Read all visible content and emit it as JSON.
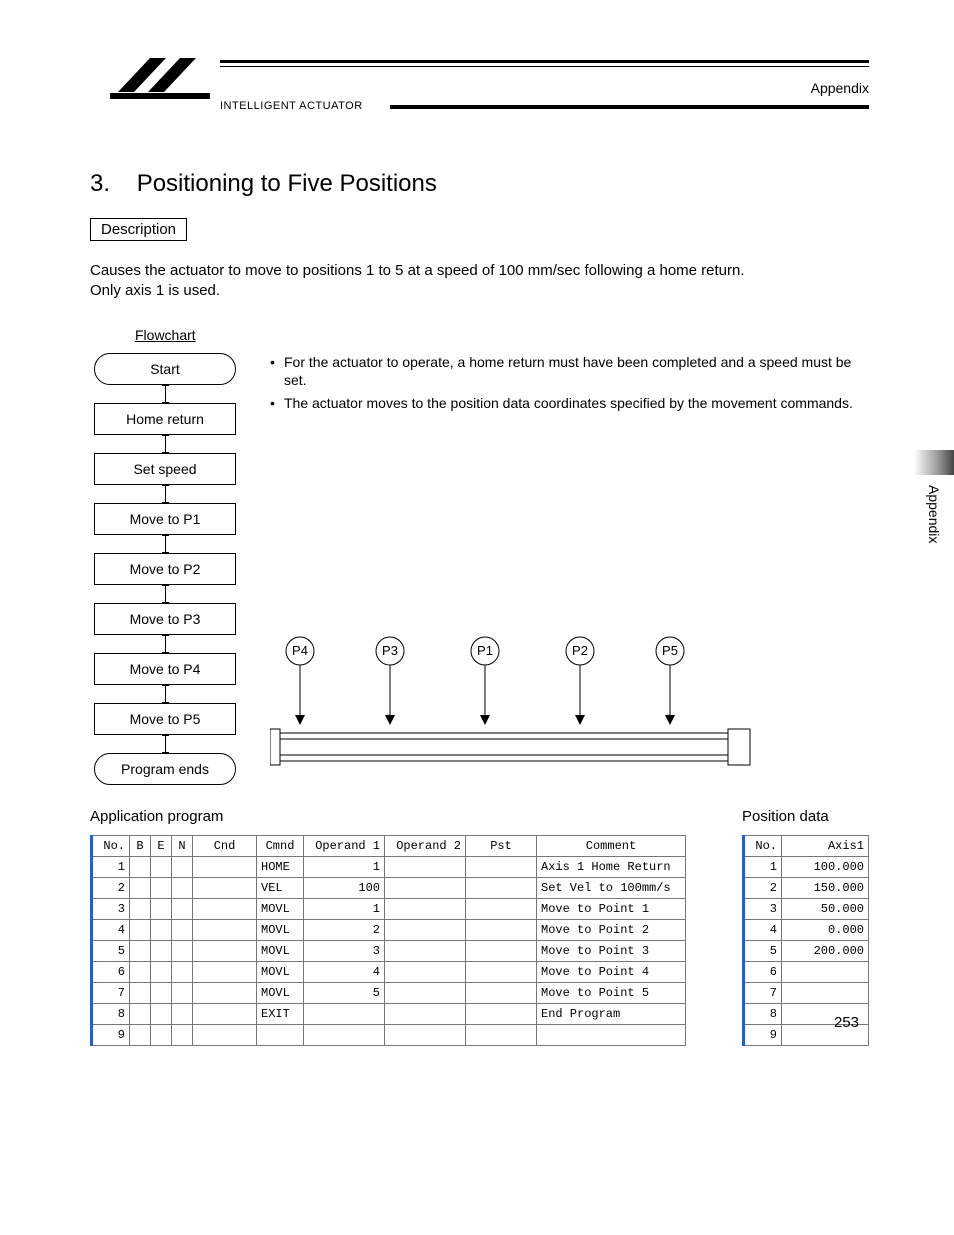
{
  "header": {
    "brand": "INTELLIGENT ACTUATOR",
    "appendix_label": "Appendix"
  },
  "section": {
    "number": "3.",
    "title": "Positioning to Five Positions",
    "description_label": "Description",
    "description_text_1": "Causes the actuator to move to positions 1 to 5 at a speed of 100 mm/sec following a home return.",
    "description_text_2": "Only axis 1 is used."
  },
  "flowchart": {
    "label": "Flowchart",
    "steps": [
      {
        "text": "Start",
        "shape": "oval"
      },
      {
        "text": "Home return",
        "shape": "rect"
      },
      {
        "text": "Set speed",
        "shape": "rect"
      },
      {
        "text": "Move to P1",
        "shape": "rect"
      },
      {
        "text": "Move to P2",
        "shape": "rect"
      },
      {
        "text": "Move to P3",
        "shape": "rect"
      },
      {
        "text": "Move to P4",
        "shape": "rect"
      },
      {
        "text": "Move to P5",
        "shape": "rect"
      },
      {
        "text": "Program ends",
        "shape": "oval"
      }
    ]
  },
  "notes": {
    "b1": "For the actuator to operate, a home return must have been completed and a speed must be set.",
    "b2": "The actuator moves to the position data coordinates specified by the movement commands."
  },
  "positions_diagram": {
    "labels": [
      "P4",
      "P3",
      "P1",
      "P2",
      "P5"
    ]
  },
  "side_tab": "Appendix",
  "app_program": {
    "title": "Application program",
    "headers": [
      "No.",
      "B",
      "E",
      "N",
      "Cnd",
      "Cmnd",
      "Operand 1",
      "Operand 2",
      "Pst",
      "Comment"
    ],
    "rows": [
      {
        "no": "1",
        "cmnd": "HOME",
        "op1": "1",
        "cmt": "Axis 1 Home Return"
      },
      {
        "no": "2",
        "cmnd": "VEL",
        "op1": "100",
        "cmt": "Set Vel to 100mm/s"
      },
      {
        "no": "3",
        "cmnd": "MOVL",
        "op1": "1",
        "cmt": "Move to Point 1"
      },
      {
        "no": "4",
        "cmnd": "MOVL",
        "op1": "2",
        "cmt": "Move to Point 2"
      },
      {
        "no": "5",
        "cmnd": "MOVL",
        "op1": "3",
        "cmt": "Move to Point 3"
      },
      {
        "no": "6",
        "cmnd": "MOVL",
        "op1": "4",
        "cmt": "Move to Point 4"
      },
      {
        "no": "7",
        "cmnd": "MOVL",
        "op1": "5",
        "cmt": "Move to Point 5"
      },
      {
        "no": "8",
        "cmnd": "EXIT",
        "op1": "",
        "cmt": "End Program"
      },
      {
        "no": "9",
        "cmnd": "",
        "op1": "",
        "cmt": ""
      }
    ]
  },
  "position_data": {
    "title": "Position data",
    "headers": [
      "No.",
      "Axis1"
    ],
    "rows": [
      {
        "no": "1",
        "ax": "100.000"
      },
      {
        "no": "2",
        "ax": "150.000"
      },
      {
        "no": "3",
        "ax": "50.000"
      },
      {
        "no": "4",
        "ax": "0.000"
      },
      {
        "no": "5",
        "ax": "200.000"
      },
      {
        "no": "6",
        "ax": ""
      },
      {
        "no": "7",
        "ax": ""
      },
      {
        "no": "8",
        "ax": ""
      },
      {
        "no": "9",
        "ax": ""
      }
    ]
  },
  "page_number": "253"
}
